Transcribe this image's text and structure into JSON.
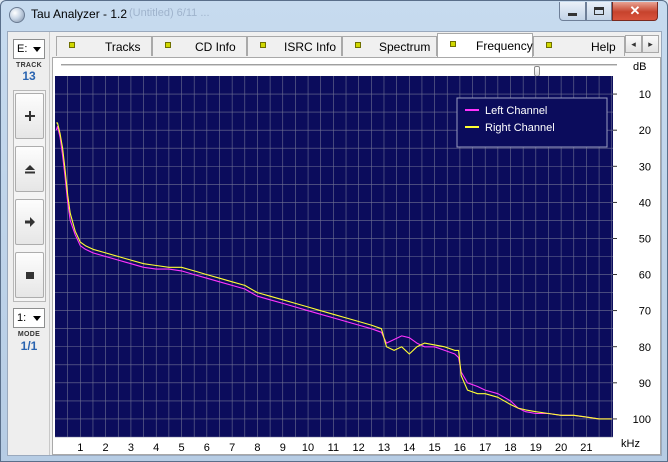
{
  "window": {
    "title": "Tau Analyzer - 1.2",
    "title_ghost": "(Untitled) 6/11 ...",
    "close_glyph": "✕"
  },
  "left_panel": {
    "drive_value": "E:",
    "track_label": "TRACK",
    "track_number": "13",
    "channel_value": "1:",
    "mode_label": "MODE",
    "mode_value": "1/1",
    "buttons": [
      {
        "name": "zoom-in-button",
        "icon": "plus-icon"
      },
      {
        "name": "eject-button",
        "icon": "eject-icon"
      },
      {
        "name": "next-button",
        "icon": "arrow-right-icon"
      },
      {
        "name": "stop-button",
        "icon": "stop-icon"
      }
    ]
  },
  "tabs": [
    {
      "label": "Tracks",
      "active": false
    },
    {
      "label": "CD Info",
      "active": false
    },
    {
      "label": "ISRC Info",
      "active": false
    },
    {
      "label": "Spectrum",
      "active": false
    },
    {
      "label": "Frequency",
      "active": true
    },
    {
      "label": "Help",
      "active": false
    }
  ],
  "tab_scroll": {
    "left": "◂",
    "right": "▸"
  },
  "plot": {
    "y_unit": "dB",
    "x_unit": "kHz",
    "slider_value": 0.86
  },
  "chart_data": {
    "type": "line",
    "title": "",
    "xlabel": "kHz",
    "ylabel": "dB",
    "xlim": [
      0,
      22.05
    ],
    "ylim": [
      -105,
      -5
    ],
    "x_ticks": [
      1,
      2,
      3,
      4,
      5,
      6,
      7,
      8,
      9,
      10,
      11,
      12,
      13,
      14,
      15,
      16,
      17,
      18,
      19,
      20,
      21
    ],
    "y_ticks": [
      -10,
      -20,
      -30,
      -40,
      -50,
      -60,
      -70,
      -80,
      -90,
      -100
    ],
    "y_tick_labels": [
      "10",
      "20",
      "30",
      "40",
      "50",
      "60",
      "70",
      "80",
      "90",
      "100"
    ],
    "grid": true,
    "legend_position": "top-right",
    "background_color": "#0b0c5c",
    "grid_color": "#6f7193",
    "series": [
      {
        "name": "Left Channel",
        "color": "#ff33ff",
        "x": [
          0.05,
          0.1,
          0.2,
          0.3,
          0.4,
          0.5,
          0.6,
          0.8,
          1.0,
          1.2,
          1.5,
          2.0,
          2.5,
          3.0,
          3.5,
          4.0,
          4.5,
          5.0,
          5.5,
          6.0,
          6.5,
          7.0,
          7.5,
          8.0,
          8.5,
          9.0,
          9.5,
          10.0,
          10.5,
          11.0,
          11.5,
          12.0,
          12.5,
          12.9,
          13.1,
          13.4,
          13.7,
          14.0,
          14.3,
          14.6,
          15.0,
          15.4,
          15.8,
          15.95,
          16.05,
          16.3,
          16.7,
          17.0,
          17.5,
          18.0,
          18.3,
          18.6,
          19.0,
          19.5,
          20.0,
          20.5,
          21.0,
          21.5,
          22.0
        ],
        "y": [
          -20,
          -19,
          -22,
          -27,
          -33,
          -40,
          -45,
          -49,
          -52,
          -53,
          -54,
          -55,
          -56,
          -57,
          -58,
          -58.5,
          -58.5,
          -59,
          -60,
          -61,
          -62,
          -63,
          -64,
          -66,
          -67,
          -68,
          -69,
          -70,
          -71,
          -72,
          -73,
          -74,
          -75,
          -76,
          -79,
          -78,
          -77,
          -77.5,
          -79,
          -80,
          -80,
          -81,
          -82,
          -83,
          -87,
          -90,
          -91,
          -92,
          -93,
          -95,
          -97,
          -98,
          -98.5,
          -98.5,
          -99,
          -99,
          -99.5,
          -100,
          -100
        ]
      },
      {
        "name": "Right Channel",
        "color": "#ffff33",
        "x": [
          0.05,
          0.1,
          0.2,
          0.3,
          0.4,
          0.5,
          0.6,
          0.8,
          1.0,
          1.2,
          1.5,
          2.0,
          2.5,
          3.0,
          3.5,
          4.0,
          4.5,
          5.0,
          5.5,
          6.0,
          6.5,
          7.0,
          7.5,
          8.0,
          8.5,
          9.0,
          9.5,
          10.0,
          10.5,
          11.0,
          11.5,
          12.0,
          12.5,
          12.9,
          13.1,
          13.4,
          13.7,
          14.0,
          14.3,
          14.6,
          15.0,
          15.4,
          15.8,
          15.95,
          16.05,
          16.3,
          16.7,
          17.0,
          17.5,
          18.0,
          18.3,
          18.6,
          19.0,
          19.5,
          20.0,
          20.5,
          21.0,
          21.5,
          22.0
        ],
        "y": [
          -18,
          -18,
          -21,
          -25,
          -31,
          -38,
          -43,
          -48,
          -51,
          -52,
          -53,
          -54,
          -55,
          -56,
          -57,
          -57.5,
          -58,
          -58,
          -59,
          -60,
          -61,
          -62,
          -63,
          -65,
          -66,
          -67,
          -68,
          -69,
          -70,
          -71,
          -72,
          -73,
          -74,
          -75,
          -80,
          -81,
          -80,
          -82,
          -80,
          -79,
          -79.5,
          -80,
          -81,
          -81,
          -88,
          -92,
          -93,
          -93,
          -94,
          -96,
          -97,
          -97.5,
          -98,
          -98.5,
          -99,
          -99,
          -99.5,
          -100,
          -100
        ]
      }
    ]
  }
}
